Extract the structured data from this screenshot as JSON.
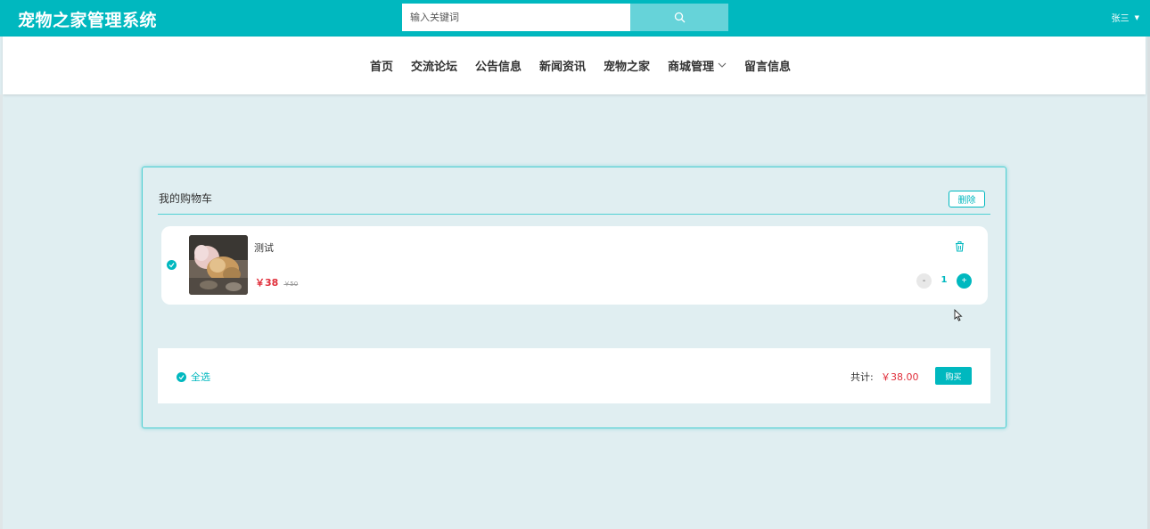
{
  "header": {
    "site_title": "宠物之家管理系统",
    "search_placeholder": "输入关键词",
    "search_icon": "search-icon",
    "user_menu_label": "张三"
  },
  "nav": {
    "items": [
      {
        "label": "首页"
      },
      {
        "label": "交流论坛"
      },
      {
        "label": "公告信息"
      },
      {
        "label": "新闻资讯"
      },
      {
        "label": "宠物之家"
      },
      {
        "label": "商城管理",
        "has_dropdown": true
      },
      {
        "label": "留言信息"
      }
    ]
  },
  "cart": {
    "title": "我的购物车",
    "delete_label": "删除",
    "items": [
      {
        "name": "测试",
        "price": "￥38",
        "original_price": "￥50",
        "quantity": "1",
        "minus_label": "-",
        "plus_label": "+",
        "selected": true
      }
    ],
    "select_all_label": "全选",
    "total_label": "共计:",
    "total_value": "￥38.00",
    "buy_label": "购买"
  },
  "colors": {
    "accent": "#00b8bf",
    "price": "#e02e3a",
    "background": "#e0eef1"
  }
}
